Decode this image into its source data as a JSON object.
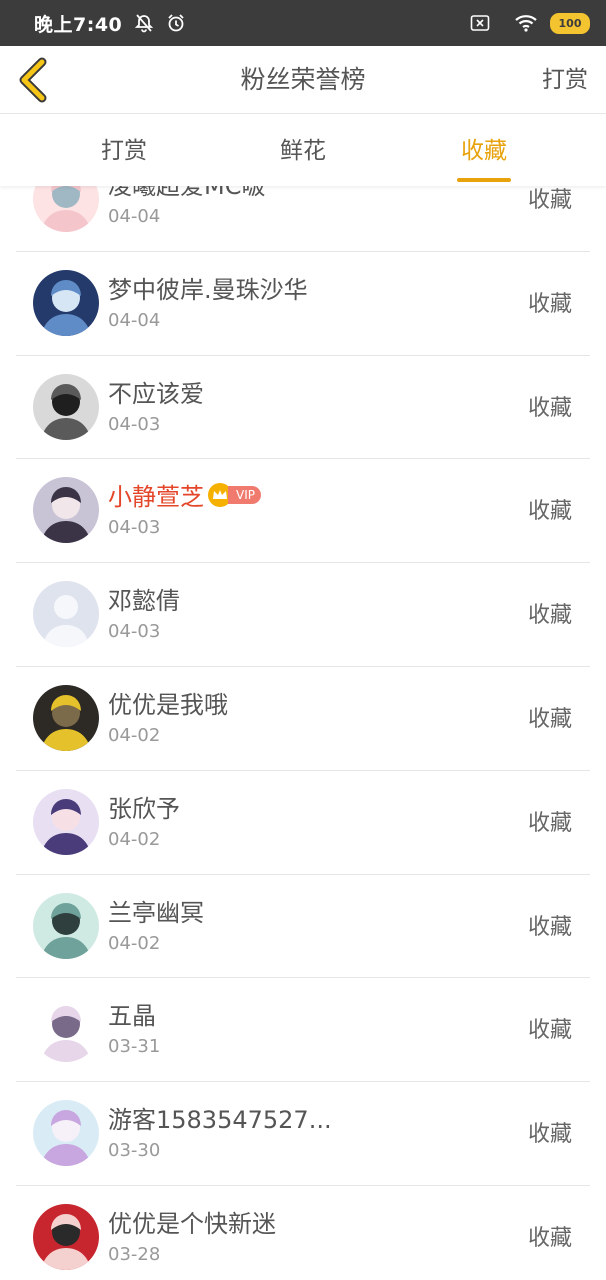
{
  "status_bar": {
    "time": "晚上7:40",
    "battery": "100"
  },
  "header": {
    "title": "粉丝荣誉榜",
    "right_action": "打赏"
  },
  "tabs": [
    {
      "label": "打赏",
      "active": false
    },
    {
      "label": "鲜花",
      "active": false
    },
    {
      "label": "收藏",
      "active": true
    }
  ],
  "colors": {
    "accent": "#e8a20c",
    "vip_name": "#e4462a"
  },
  "fans": [
    {
      "name": "凌曦超爱MC啵",
      "date": "04-04",
      "action": "收藏",
      "vip": false
    },
    {
      "name": "梦中彼岸.曼珠沙华",
      "date": "04-04",
      "action": "收藏",
      "vip": false
    },
    {
      "name": "不应该爱",
      "date": "04-03",
      "action": "收藏",
      "vip": false
    },
    {
      "name": "小静萱芝",
      "date": "04-03",
      "action": "收藏",
      "vip": true,
      "badge": "VIP"
    },
    {
      "name": "邓懿倩",
      "date": "04-03",
      "action": "收藏",
      "vip": false
    },
    {
      "name": "优优是我哦",
      "date": "04-02",
      "action": "收藏",
      "vip": false
    },
    {
      "name": "张欣予",
      "date": "04-02",
      "action": "收藏",
      "vip": false
    },
    {
      "name": "兰亭幽冥",
      "date": "04-02",
      "action": "收藏",
      "vip": false
    },
    {
      "name": "五晶",
      "date": "03-31",
      "action": "收藏",
      "vip": false
    },
    {
      "name": "游客1583547527...",
      "date": "03-30",
      "action": "收藏",
      "vip": false
    },
    {
      "name": "优优是个快新迷",
      "date": "03-28",
      "action": "收藏",
      "vip": false
    }
  ]
}
